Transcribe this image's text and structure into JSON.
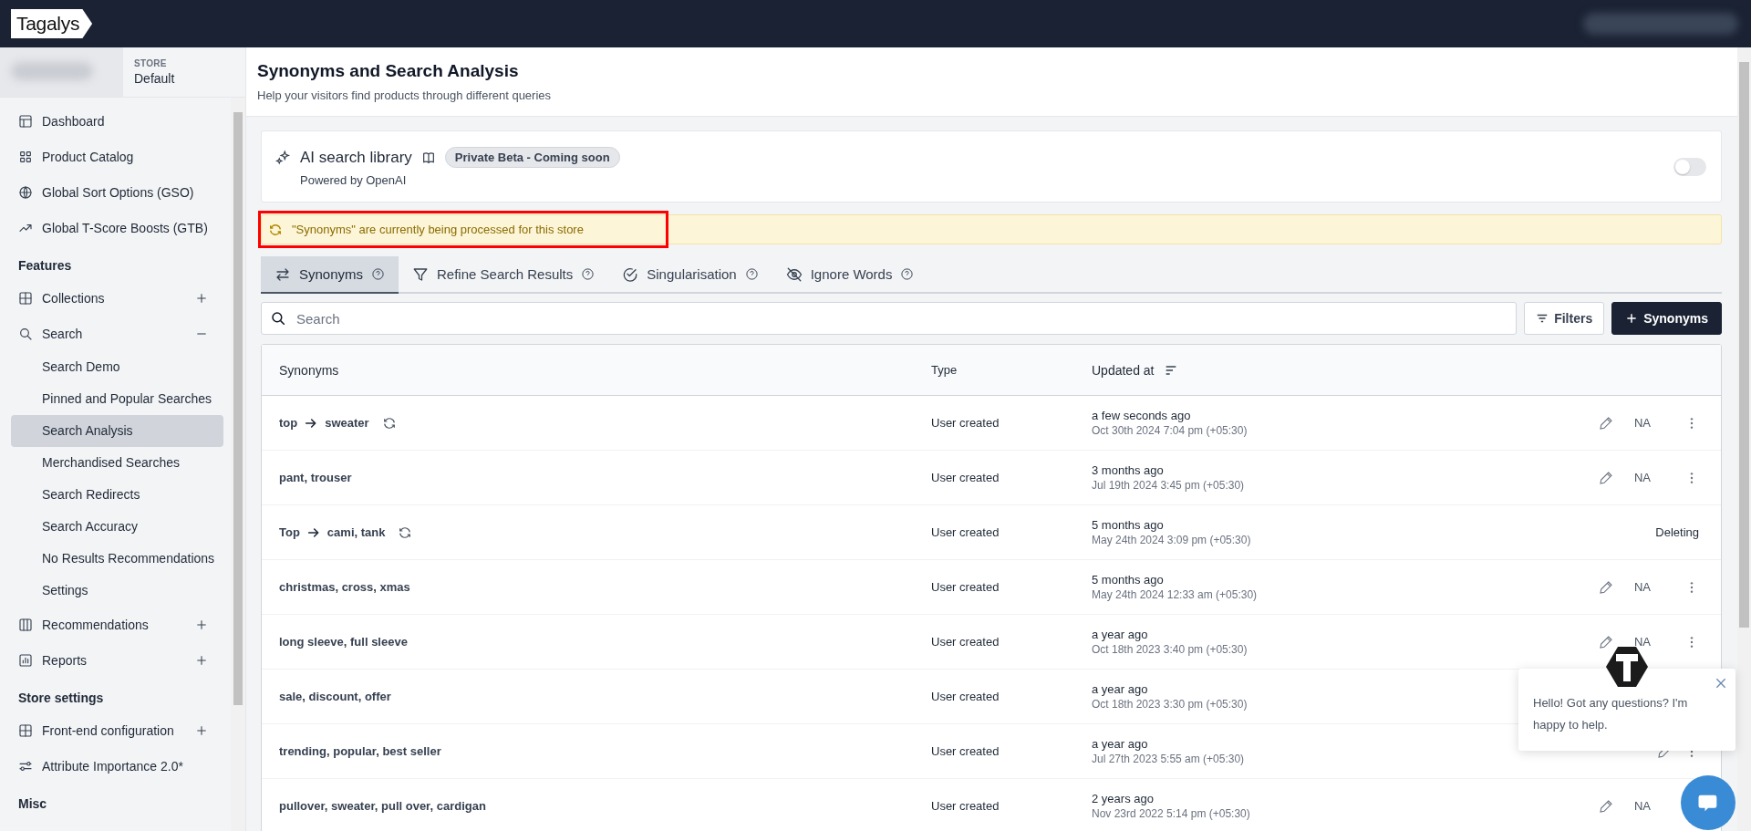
{
  "app": {
    "logo": "Tagalys"
  },
  "store": {
    "label": "STORE",
    "value": "Default"
  },
  "sidebar": {
    "sections": [
      {
        "items": [
          {
            "label": "Dashboard"
          },
          {
            "label": "Product Catalog"
          },
          {
            "label": "Global Sort Options (GSO)"
          },
          {
            "label": "Global T-Score Boosts (GTB)"
          }
        ]
      },
      {
        "heading": "Features",
        "items": [
          {
            "label": "Collections",
            "expanded": false
          },
          {
            "label": "Search",
            "expanded": true,
            "children": [
              {
                "label": "Search Demo",
                "selected": false
              },
              {
                "label": "Pinned and Popular Searches",
                "selected": false
              },
              {
                "label": "Search Analysis",
                "selected": true
              },
              {
                "label": "Merchandised Searches",
                "selected": false
              },
              {
                "label": "Search Redirects",
                "selected": false
              },
              {
                "label": "Search Accuracy",
                "selected": false
              },
              {
                "label": "No Results Recommendations",
                "selected": false
              },
              {
                "label": "Settings",
                "selected": false
              }
            ]
          },
          {
            "label": "Recommendations",
            "expanded": false
          },
          {
            "label": "Reports",
            "expanded": false
          }
        ]
      },
      {
        "heading": "Store settings",
        "items": [
          {
            "label": "Front-end configuration",
            "expanded": false
          },
          {
            "label": "Attribute Importance 2.0*"
          }
        ]
      },
      {
        "heading": "Misc"
      }
    ]
  },
  "page": {
    "title": "Synonyms and Search Analysis",
    "subtitle": "Help your visitors find products through different queries"
  },
  "ai_card": {
    "title": "AI search library",
    "badge": "Private Beta - Coming soon",
    "powered_by": "Powered by OpenAI",
    "on": false
  },
  "banner": {
    "text": "\"Synonyms\" are currently being processed for this store",
    "highlighted": true
  },
  "tabs": [
    {
      "label": "Synonyms",
      "selected": true
    },
    {
      "label": "Refine Search Results",
      "selected": false
    },
    {
      "label": "Singularisation",
      "selected": false
    },
    {
      "label": "Ignore Words",
      "selected": false
    }
  ],
  "search": {
    "placeholder": "Search"
  },
  "buttons": {
    "filters": "Filters",
    "add": "Synonyms"
  },
  "table": {
    "columns": [
      "Synonyms",
      "Type",
      "Updated at"
    ],
    "rows": [
      {
        "kind": "oneway",
        "from": "top",
        "to": "sweater",
        "processing": true,
        "type": "User created",
        "updated": "a few seconds ago",
        "date": "Oct 30th 2024 7:04 pm (+05:30)",
        "status": "NA",
        "editable": true
      },
      {
        "kind": "equivalent",
        "text": "pant, trouser",
        "processing": false,
        "type": "User created",
        "updated": "3 months ago",
        "date": "Jul 19th 2024 3:45 pm (+05:30)",
        "status": "NA",
        "editable": true
      },
      {
        "kind": "oneway",
        "from": "Top",
        "to": "cami, tank",
        "processing": true,
        "type": "User created",
        "updated": "5 months ago",
        "date": "May 24th 2024 3:09 pm (+05:30)",
        "status": "Deleting",
        "editable": false
      },
      {
        "kind": "equivalent",
        "text": "christmas, cross, xmas",
        "processing": false,
        "type": "User created",
        "updated": "5 months ago",
        "date": "May 24th 2024 12:33 am (+05:30)",
        "status": "NA",
        "editable": true
      },
      {
        "kind": "equivalent",
        "text": "long sleeve, full sleeve",
        "processing": false,
        "type": "User created",
        "updated": "a year ago",
        "date": "Oct 18th 2023 3:40 pm (+05:30)",
        "status": "NA",
        "editable": true
      },
      {
        "kind": "equivalent",
        "text": "sale, discount, offer",
        "processing": false,
        "type": "User created",
        "updated": "a year ago",
        "date": "Oct 18th 2023 3:30 pm (+05:30)",
        "editable": false
      },
      {
        "kind": "equivalent",
        "text": "trending, popular, best seller",
        "processing": false,
        "type": "User created",
        "updated": "a year ago",
        "date": "Jul 27th 2023 5:55 am (+05:30)",
        "editable": true
      },
      {
        "kind": "equivalent",
        "text": "pullover, sweater, pull over, cardigan",
        "processing": false,
        "type": "User created",
        "updated": "2 years ago",
        "date": "Nov 23rd 2022 5:14 pm (+05:30)",
        "status": "NA",
        "editable": true
      }
    ]
  },
  "chat": {
    "message": "Hello! Got any questions? I'm happy to help."
  }
}
